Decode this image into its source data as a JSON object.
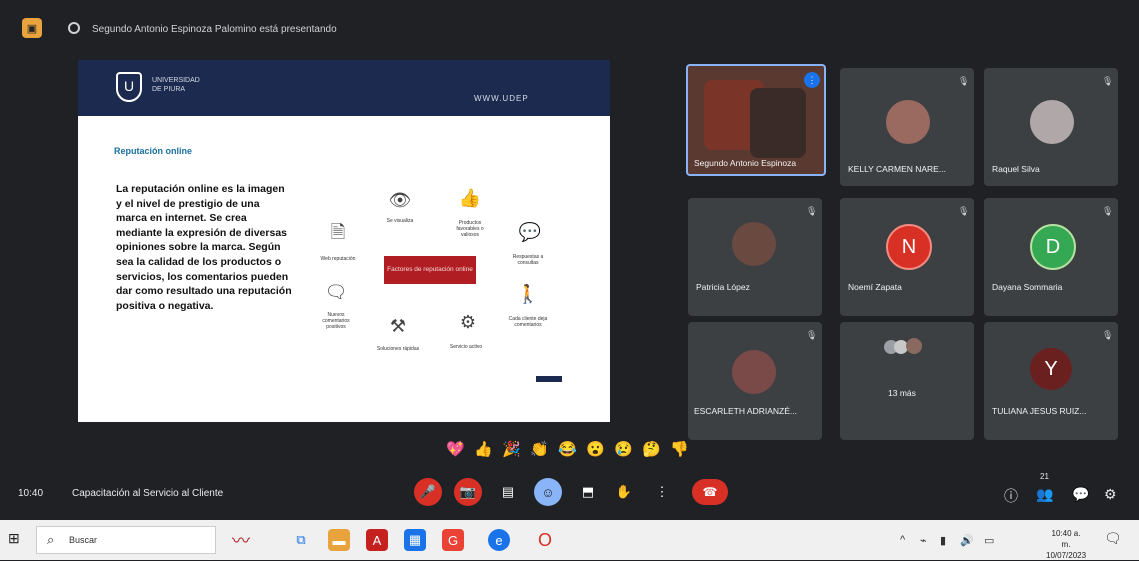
{
  "topbar": {
    "presenter_text": "Segundo Antonio Espinoza Palomino está presentando"
  },
  "slide": {
    "logo_text": "UNIVERSIDAD DE PIURA",
    "header_right": "WWW.UDEP",
    "title": "Reputación online",
    "body": "La reputación online es la imagen y el nivel de prestigio de una marca en internet. Se crea mediante la expresión de diversas opiniones sobre la marca. Según sea la calidad de los productos o servicios, los comentarios pueden dar como resultado una reputación positiva o negativa.",
    "center_label": "Factores de reputación online",
    "hub": [
      {
        "icon": "eye-icon",
        "label": "Se visualiza"
      },
      {
        "icon": "thumbs-up-icon",
        "label": "Productos favorables o valiosos"
      },
      {
        "icon": "chat-icon",
        "label": "Respuestas a consultas"
      },
      {
        "icon": "document-icon",
        "label": "Web reputación"
      },
      {
        "icon": "comment-icon",
        "label": "Nuevos comentarios positivos"
      },
      {
        "icon": "tools-icon",
        "label": "Soluciones rápidas"
      },
      {
        "icon": "gear-icon",
        "label": "Servicio activo"
      },
      {
        "icon": "person-icon",
        "label": "Cada cliente deja comentarios"
      }
    ]
  },
  "participants": [
    {
      "name": "Segundo Antonio Espinoza",
      "type": "video"
    },
    {
      "name": "KELLY CARMEN NARE...",
      "type": "photo"
    },
    {
      "name": "Raquel Silva",
      "type": "photo"
    },
    {
      "name": "Patricia López",
      "type": "photo"
    },
    {
      "name": "Noemí Zapata",
      "type": "letter",
      "letter": "N",
      "color": "#d93025"
    },
    {
      "name": "Dayana Sommaria",
      "type": "letter",
      "letter": "D",
      "color": "#34a853"
    },
    {
      "name": "ESCARLETH ADRIANZÉ...",
      "type": "photo"
    },
    {
      "name": "13 más",
      "type": "group"
    },
    {
      "name": "TULIANA JESUS RUIZ...",
      "type": "letter",
      "letter": "Y",
      "color": "#6b2020"
    }
  ],
  "reactions": [
    "💖",
    "👍",
    "🎉",
    "👏",
    "😂",
    "😮",
    "😢",
    "🤔",
    "👎"
  ],
  "bottom": {
    "time": "10:40",
    "meeting_title": "Capacitación al Servicio al Cliente",
    "participant_count": "21"
  },
  "taskbar": {
    "search_placeholder": "Buscar",
    "clock_time": "10:40 a. m.",
    "clock_date": "10/07/2023"
  }
}
